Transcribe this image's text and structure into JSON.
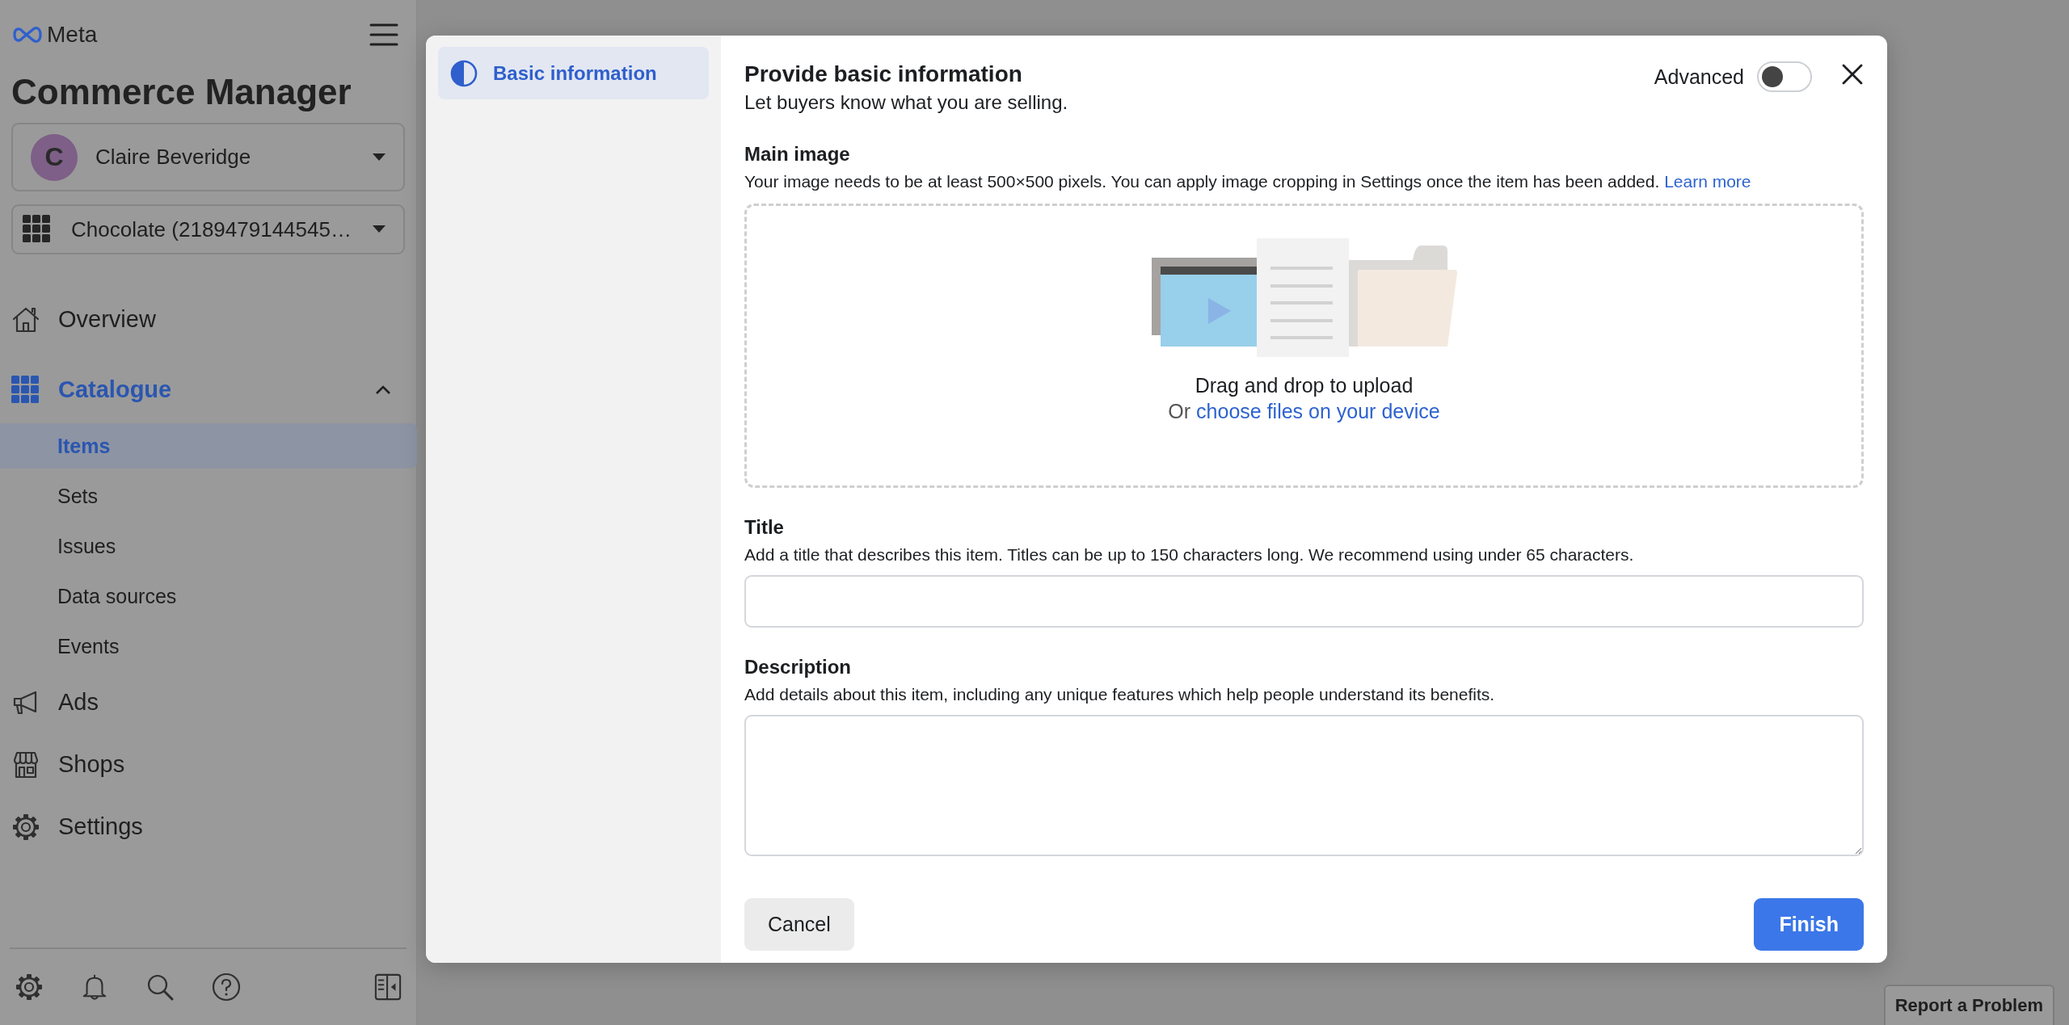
{
  "sidebar": {
    "brand": "Meta",
    "app_title": "Commerce Manager",
    "account": {
      "initial": "C",
      "name": "Claire Beveridge"
    },
    "catalogue_picker": {
      "label": "Chocolate (2189479144545…"
    },
    "nav": [
      {
        "label": "Overview",
        "selected": false
      },
      {
        "label": "Catalogue",
        "selected": true,
        "expanded": true,
        "children": [
          {
            "label": "Items",
            "selected": true
          },
          {
            "label": "Sets",
            "selected": false
          },
          {
            "label": "Issues",
            "selected": false
          },
          {
            "label": "Data sources",
            "selected": false
          },
          {
            "label": "Events",
            "selected": false
          }
        ]
      },
      {
        "label": "Ads",
        "selected": false
      },
      {
        "label": "Shops",
        "selected": false
      },
      {
        "label": "Settings",
        "selected": false
      }
    ]
  },
  "modal": {
    "steps": [
      {
        "label": "Basic information",
        "selected": true
      }
    ],
    "title": "Provide basic information",
    "subtitle": "Let buyers know what you are selling.",
    "advanced": {
      "label": "Advanced",
      "on": false
    },
    "main_image": {
      "heading": "Main image",
      "help": "Your image needs to be at least 500×500 pixels. You can apply image cropping in Settings once the item has been added.",
      "help_link": "Learn more",
      "drop_text": "Drag and drop to upload",
      "or_text": "Or",
      "choose_link": "choose files on your device"
    },
    "title_field": {
      "heading": "Title",
      "help": "Add a title that describes this item. Titles can be up to 150 characters long. We recommend using under 65 characters."
    },
    "description_field": {
      "heading": "Description",
      "help": "Add details about this item, including any unique features which help people understand its benefits."
    },
    "buttons": {
      "cancel": "Cancel",
      "finish": "Finish"
    }
  },
  "report_button": "Report a Problem"
}
